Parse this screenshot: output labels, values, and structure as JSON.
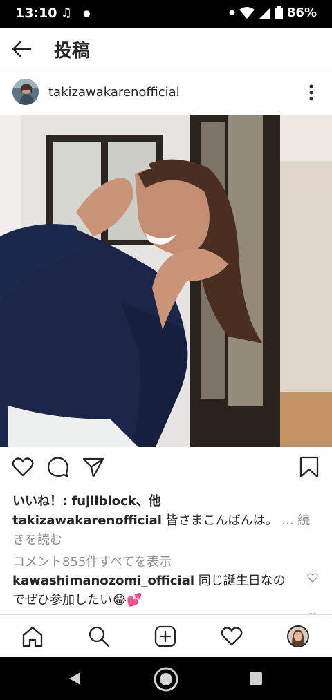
{
  "status_bar": {
    "time": "13:10",
    "battery": "86%",
    "icons": [
      "music-note-icon",
      "dot-icon",
      "dot-icon",
      "wifi-icon",
      "signal-icon",
      "battery-icon"
    ]
  },
  "header": {
    "title": "投稿",
    "back_icon": "arrow-left-icon"
  },
  "post": {
    "username": "takizawakarenofficial",
    "more_icon": "more-vertical-icon",
    "actions": [
      "heart-icon",
      "comment-icon",
      "share-icon",
      "bookmark-icon"
    ],
    "likes_text": "いいね！: fujiiblock、他",
    "caption": {
      "username": "takizawakarenofficial",
      "text": "皆さまこんばんは。",
      "ellipsis": "...",
      "more_label": "続きを読む"
    },
    "view_all_comments": "コメント855件すべてを表示",
    "comment": {
      "username": "kawashimanozomi_official",
      "text": "同じ誕生日なのでぜひ参加したい😂💕"
    }
  },
  "bottom_nav": {
    "items": [
      "home-icon",
      "search-icon",
      "add-post-icon",
      "activity-heart-icon",
      "profile-avatar"
    ]
  },
  "android_nav": {
    "items": [
      "back-triangle-icon",
      "home-circle-icon",
      "recents-square-icon"
    ]
  },
  "colors": {
    "text": "#262626",
    "secondary": "#8e8e8e",
    "divider": "#dbdbdb",
    "sweater": "#1a2547"
  }
}
